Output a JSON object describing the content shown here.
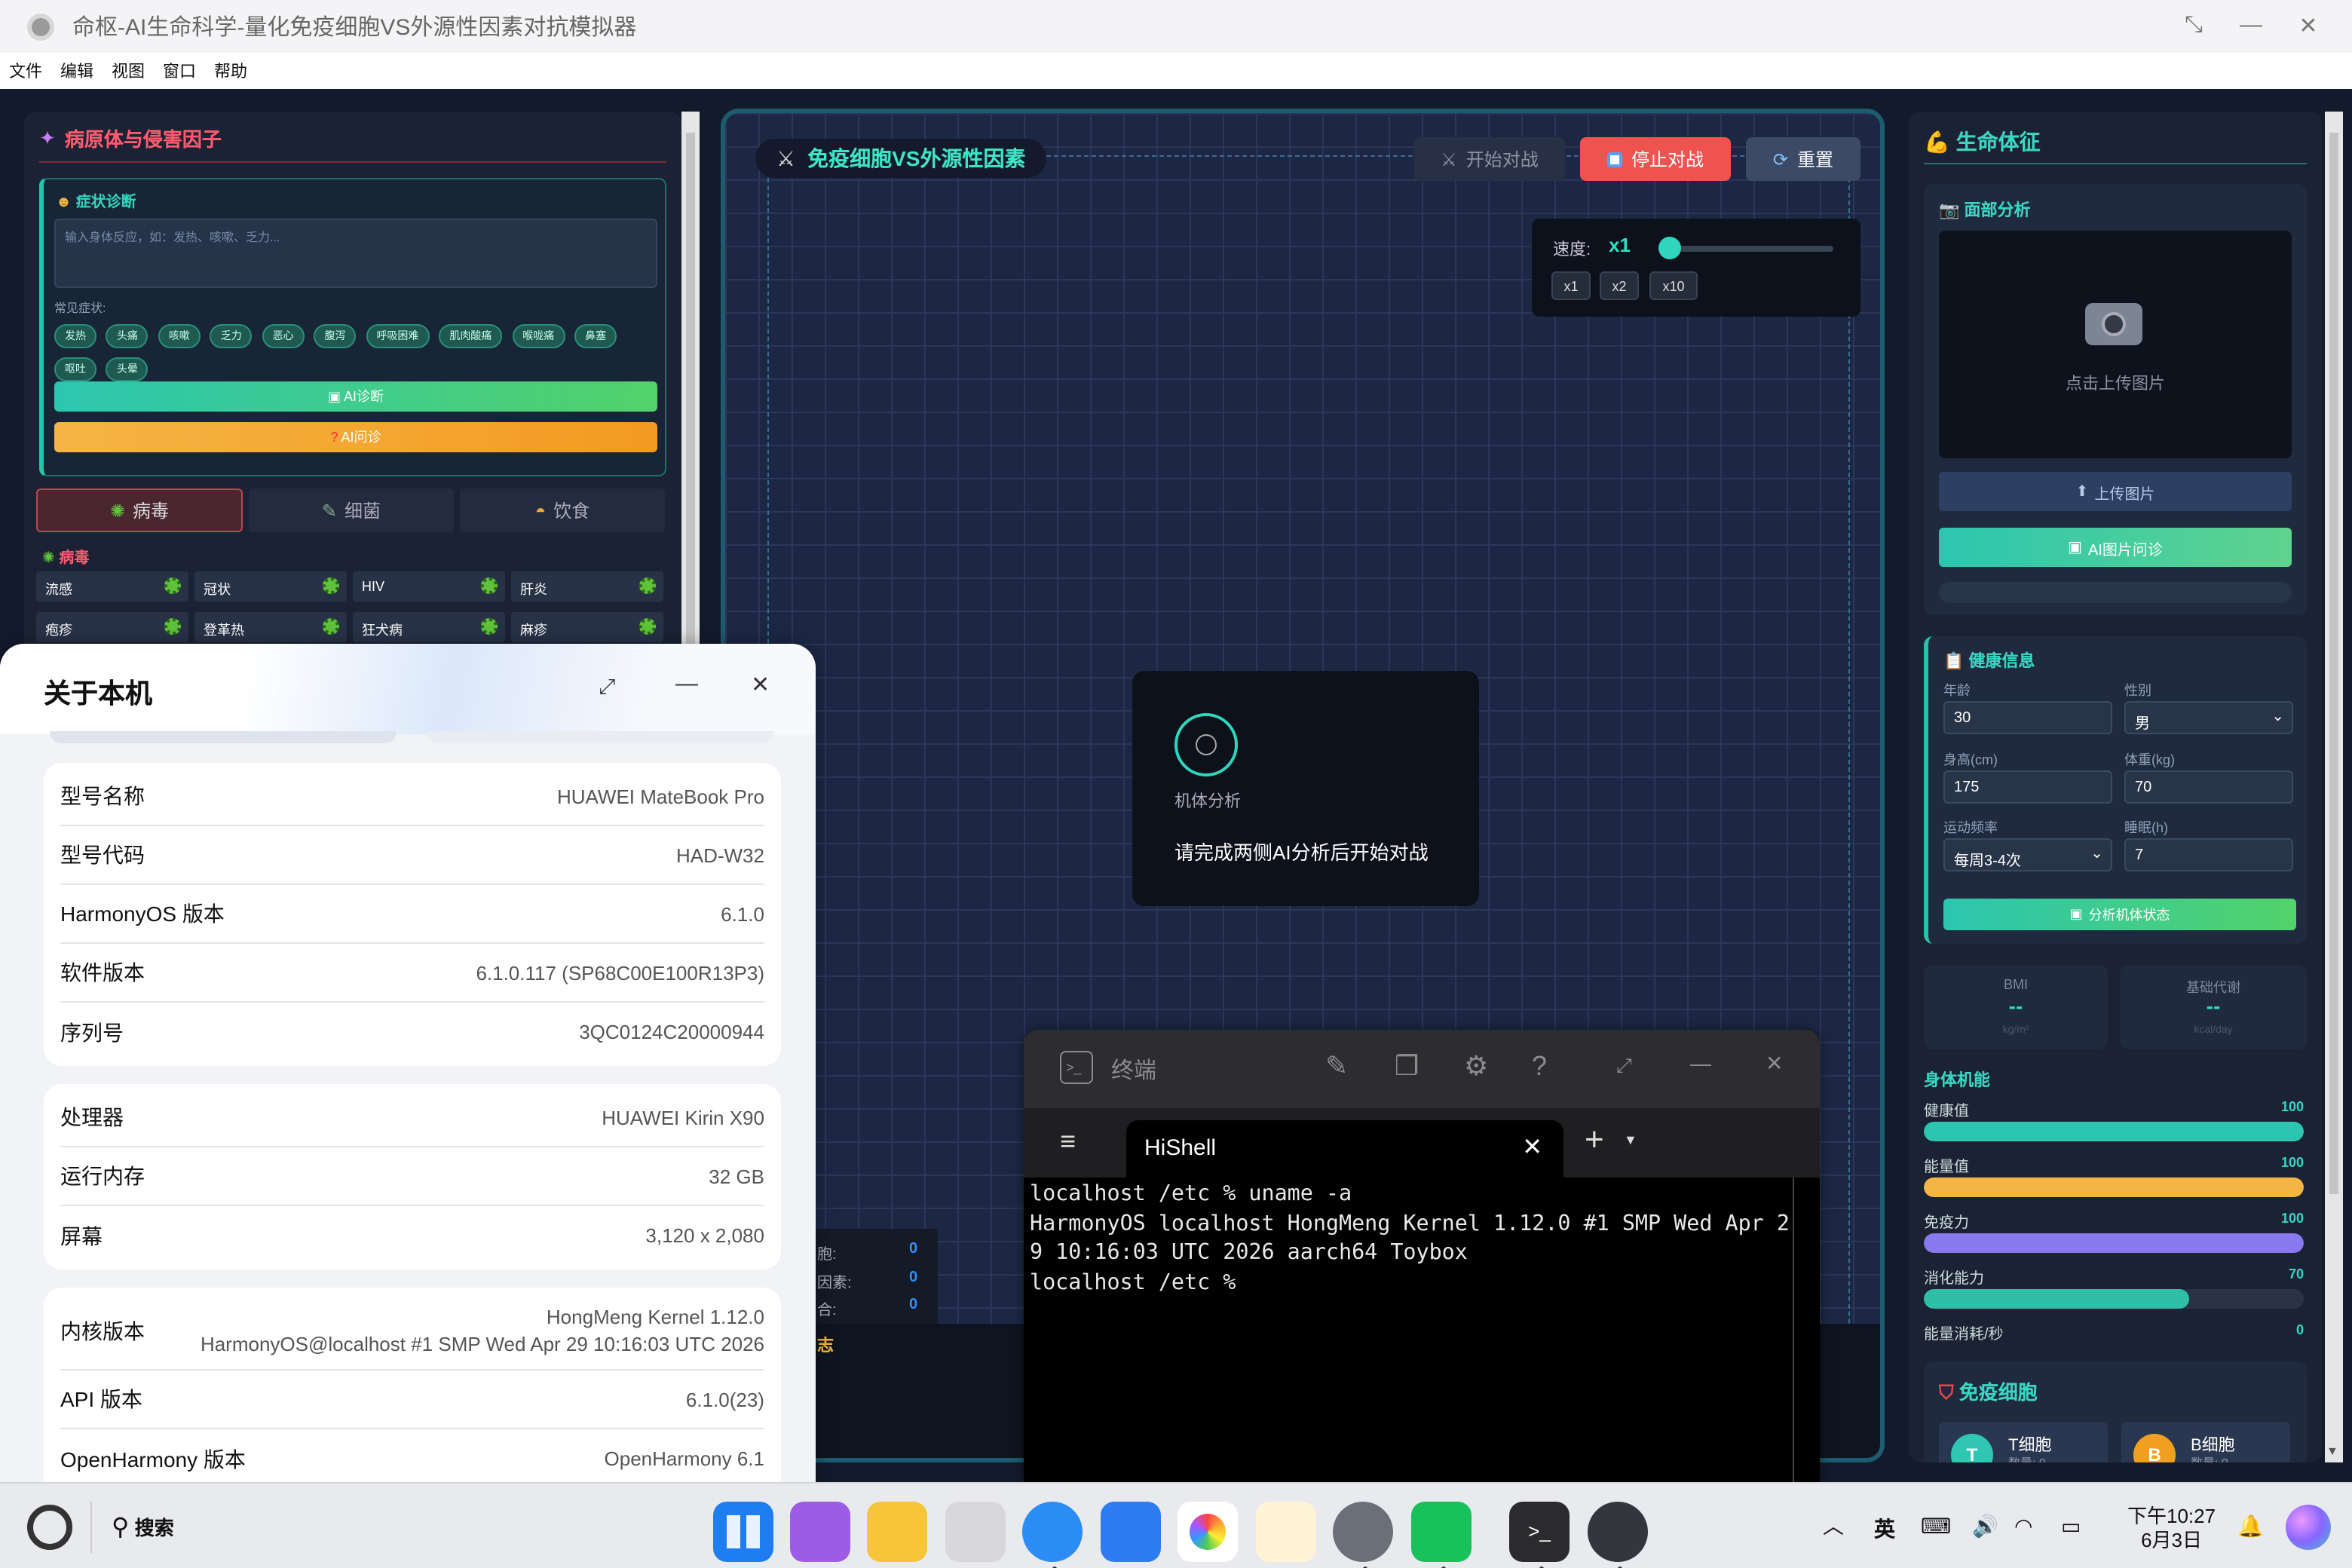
{
  "window": {
    "title": "命枢-AI生命科学-量化免疫细胞VS外源性因素对抗模拟器",
    "controls": {
      "restore": "⤡",
      "minimize": "—",
      "close": "✕"
    }
  },
  "menu": [
    "文件",
    "编辑",
    "视图",
    "窗口",
    "帮助"
  ],
  "left": {
    "title": "病原体与侵害因子",
    "diagnosis": {
      "title": "症状诊断",
      "placeholder": "输入身体反应，如：发热、咳嗽、乏力...",
      "common_label": "常见症状:",
      "chips": [
        "发热",
        "头痛",
        "咳嗽",
        "乏力",
        "恶心",
        "腹泻",
        "呼吸困难",
        "肌肉酸痛",
        "喉咙痛",
        "鼻塞",
        "呕吐",
        "头晕"
      ],
      "ai_btn": "AI诊断",
      "ask_btn": "AI问诊"
    },
    "tabs": [
      "病毒",
      "细菌",
      "饮食"
    ],
    "section": "病毒",
    "grid": [
      "流感",
      "冠状",
      "HIV",
      "肝炎",
      "疱疹",
      "登革热",
      "狂犬病",
      "麻疹"
    ]
  },
  "arena": {
    "title": "免疫细胞VS外源性因素",
    "start": "开始对战",
    "stop": "停止对战",
    "reset": "重置",
    "speed_label": "速度:",
    "speed_value": "x1",
    "speed_options": [
      "x1",
      "x2",
      "x10"
    ],
    "modal_label": "机体分析",
    "modal_text": "请完成两侧AI分析后开始对战",
    "stats": [
      {
        "label": "胞:",
        "value": "0"
      },
      {
        "label": "因素:",
        "value": "0"
      },
      {
        "label": "合:",
        "value": "0"
      }
    ],
    "log_label": "志"
  },
  "right": {
    "title": "生命体征",
    "face": {
      "title": "面部分析",
      "upload_hint": "点击上传图片",
      "upload_btn": "上传图片",
      "ai_btn": "AI图片问诊"
    },
    "health": {
      "title": "健康信息",
      "age_label": "年龄",
      "age": "30",
      "gender_label": "性别",
      "gender": "男",
      "height_label": "身高(cm)",
      "height": "175",
      "weight_label": "体重(kg)",
      "weight": "70",
      "exercise_label": "运动频率",
      "exercise": "每周3-4次",
      "sleep_label": "睡眠(h)",
      "sleep": "7",
      "analyze_btn": "分析机体状态"
    },
    "bmi": {
      "label": "BMI",
      "value": "--",
      "unit": "kg/m²"
    },
    "bmr": {
      "label": "基础代谢",
      "value": "--",
      "unit": "kcal/day"
    },
    "functions_title": "身体机能",
    "bars": [
      {
        "label": "健康值",
        "value": 100,
        "pct": 1.0,
        "color": "#2cc6b0"
      },
      {
        "label": "能量值",
        "value": 100,
        "pct": 1.0,
        "color": "#f5b544"
      },
      {
        "label": "免疫力",
        "value": 100,
        "pct": 1.0,
        "color": "#8a78ee"
      },
      {
        "label": "消化能力",
        "value": 70,
        "pct": 0.7,
        "color": "#2fbfa8"
      }
    ],
    "energy_label": "能量消耗/秒",
    "energy_value": "0",
    "immune_title": "免疫细胞",
    "cells": [
      {
        "badge": "T",
        "name": "T细胞",
        "sub": "数量: 0"
      },
      {
        "badge": "B",
        "name": "B细胞",
        "sub": "数量: 0"
      }
    ]
  },
  "about": {
    "title": "关于本机",
    "group1": [
      {
        "k": "型号名称",
        "v": "HUAWEI MateBook Pro"
      },
      {
        "k": "型号代码",
        "v": "HAD-W32"
      },
      {
        "k": "HarmonyOS 版本",
        "v": "6.1.0"
      },
      {
        "k": "软件版本",
        "v": "6.1.0.117 (SP68C00E100R13P3)"
      },
      {
        "k": "序列号",
        "v": "3QC0124C20000944"
      }
    ],
    "group2": [
      {
        "k": "处理器",
        "v": "HUAWEI Kirin X90"
      },
      {
        "k": "运行内存",
        "v": "32 GB"
      },
      {
        "k": "屏幕",
        "v": "3,120 x 2,080"
      }
    ],
    "kernel_label": "内核版本",
    "kernel_line1": "HongMeng Kernel 1.12.0",
    "kernel_line2": "HarmonyOS@localhost #1 SMP Wed Apr 29 10:16:03 UTC 2026",
    "api_label": "API 版本",
    "api": "6.1.0(23)",
    "oh_label": "OpenHarmony 版本",
    "oh": "OpenHarmony 6.1"
  },
  "terminal": {
    "title": "终端",
    "tab": "HiShell",
    "lines": [
      "localhost /etc % uname -a",
      "HarmonyOS localhost HongMeng Kernel 1.12.0 #1 SMP Wed Apr 2",
      "9 10:16:03 UTC 2026 aarch64 Toybox",
      "localhost /etc %"
    ]
  },
  "taskbar": {
    "search": "搜索",
    "ime": "英",
    "time": "下午10:27",
    "date": "6月3日"
  }
}
